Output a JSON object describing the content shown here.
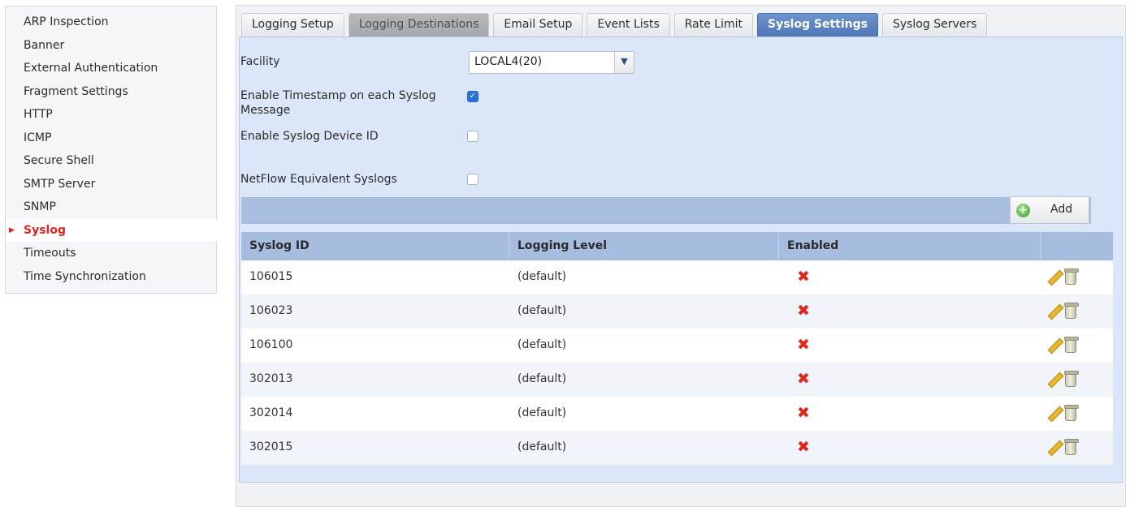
{
  "sidebar": {
    "items": [
      {
        "label": "ARP Inspection"
      },
      {
        "label": "Banner"
      },
      {
        "label": "External Authentication"
      },
      {
        "label": "Fragment Settings"
      },
      {
        "label": "HTTP"
      },
      {
        "label": "ICMP"
      },
      {
        "label": "Secure Shell"
      },
      {
        "label": "SMTP Server"
      },
      {
        "label": "SNMP"
      },
      {
        "label": "Syslog",
        "active": true
      },
      {
        "label": "Timeouts"
      },
      {
        "label": "Time Synchronization"
      }
    ]
  },
  "tabs": [
    {
      "label": "Logging Setup"
    },
    {
      "label": "Logging Destinations"
    },
    {
      "label": "Email Setup"
    },
    {
      "label": "Event Lists"
    },
    {
      "label": "Rate Limit"
    },
    {
      "label": "Syslog Settings",
      "active": true
    },
    {
      "label": "Syslog Servers"
    }
  ],
  "form": {
    "facility_label": "Facility",
    "facility_value": "LOCAL4(20)",
    "timestamp_label_line1": "Enable Timestamp on each Syslog",
    "timestamp_label_line2": "Message",
    "timestamp_checked": true,
    "device_id_label": "Enable Syslog Device ID",
    "device_id_checked": false,
    "netflow_label": "NetFlow Equivalent Syslogs",
    "netflow_checked": false
  },
  "toolbar": {
    "add_label": "Add"
  },
  "table": {
    "headers": [
      "Syslog ID",
      "Logging Level",
      "Enabled",
      ""
    ],
    "rows": [
      {
        "id": "106015",
        "level": "(default)",
        "enabled": false
      },
      {
        "id": "106023",
        "level": "(default)",
        "enabled": false
      },
      {
        "id": "106100",
        "level": "(default)",
        "enabled": false
      },
      {
        "id": "302013",
        "level": "(default)",
        "enabled": false
      },
      {
        "id": "302014",
        "level": "(default)",
        "enabled": false
      },
      {
        "id": "302015",
        "level": "(default)",
        "enabled": false
      }
    ],
    "disabled_glyph": "✖"
  },
  "colors": {
    "active_tab": "#5a83c0",
    "active_sidebar_text": "#e0231f",
    "content_bg": "#dbe7f8",
    "header_bg": "#a6bde0"
  }
}
